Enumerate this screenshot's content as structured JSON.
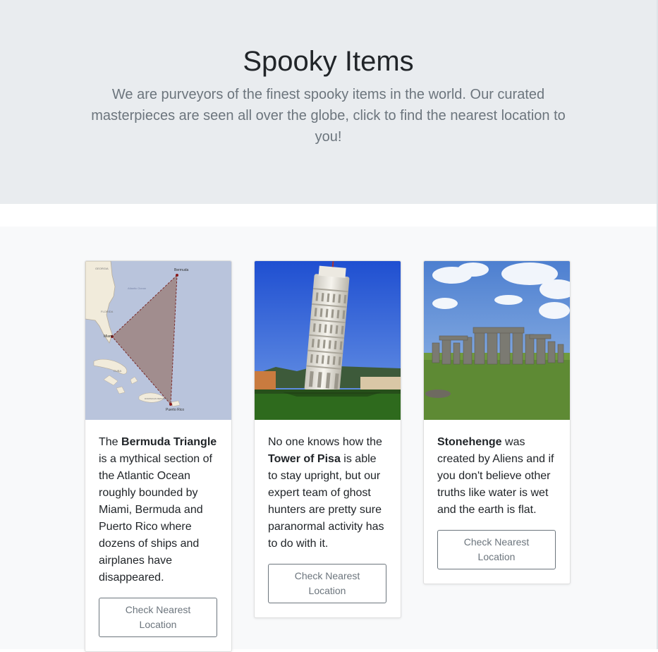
{
  "hero": {
    "title": "Spooky Items",
    "lead": "We are purveyors of the finest spooky items in the world. Our curated masterpieces are seen all over the globe, click to find the nearest location to you!"
  },
  "map_labels": {
    "bermuda": "Bermuda",
    "miami": "Miami",
    "puerto_rico": "Puerto Rico",
    "florida": "FLORIDA",
    "georgia": "GEORGIA",
    "atlantic": "Atlantic Ocean",
    "cuba": "CUBA",
    "dominican": "DOMINICAN REPUBLIC"
  },
  "cards": [
    {
      "image": "bermuda-triangle-map",
      "text_pre": "The ",
      "text_bold": "Bermuda Triangle",
      "text_post": " is a mythical section of the Atlantic Ocean roughly bounded by Miami, Bermuda and Puerto Rico where dozens of ships and airplanes have disappeared.",
      "button": "Check Nearest Location"
    },
    {
      "image": "tower-of-pisa-photo",
      "text_pre": "No one knows how the ",
      "text_bold": "Tower of Pisa",
      "text_post": " is able to stay upright, but our expert team of ghost hunters are pretty sure paranormal activity has to do with it.",
      "button": "Check Nearest Location"
    },
    {
      "image": "stonehenge-photo",
      "text_pre": "",
      "text_bold": "Stonehenge",
      "text_post": " was created by Aliens and if you don't believe other truths like water is wet and the earth is flat.",
      "button": "Check Nearest Location"
    }
  ]
}
